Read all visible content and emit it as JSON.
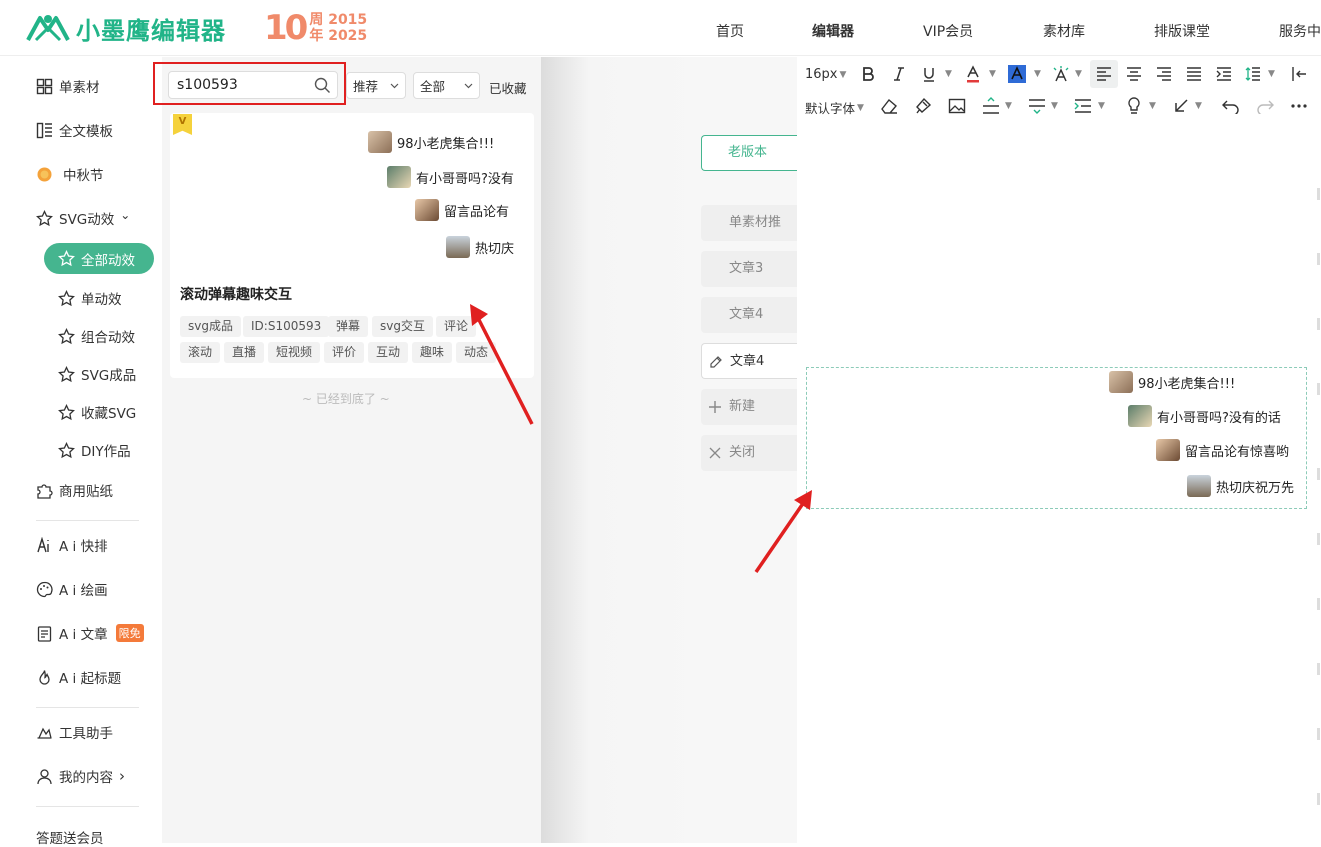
{
  "header": {
    "logo_text": "小墨鹰编辑器",
    "anniversary": {
      "number": "10",
      "year_start": "周 2015",
      "year_end": "年 2025"
    },
    "nav": [
      "首页",
      "编辑器",
      "VIP会员",
      "素材库",
      "排版课堂",
      "服务中"
    ]
  },
  "sidebar": {
    "items": [
      {
        "label": "单素材",
        "icon": "grid-icon"
      },
      {
        "label": "全文模板",
        "icon": "template-icon"
      },
      {
        "label": "中秋节",
        "icon": "moon-icon"
      },
      {
        "label": "SVG动效",
        "icon": "star-icon"
      }
    ],
    "svg_chevron": "⌄",
    "active_sub": "全部动效",
    "sub_items": [
      "单动效",
      "组合动效",
      "SVG成品",
      "收藏SVG",
      "DIY作品"
    ],
    "sticker": "商用贴纸",
    "ai": [
      {
        "label": "A i 快排",
        "icon": "ai-icon"
      },
      {
        "label": "A i 绘画",
        "icon": "palette-icon"
      },
      {
        "label": "A i 文章",
        "icon": "doc-icon",
        "badge": "限免"
      },
      {
        "label": "A i 起标题",
        "icon": "fire-icon"
      }
    ],
    "tools": "工具助手",
    "my_content": "我的内容",
    "my_content_chevron": "›",
    "quiz": "答题送会员"
  },
  "panel": {
    "search_value": "s100593",
    "sort_label": "推荐",
    "scope_label": "全部",
    "favorites": "已收藏",
    "vip_mark": "V",
    "card": {
      "danmaku": [
        "98小老虎集合!!!",
        "有小哥哥吗?没有",
        "留言品论有",
        "热切庆"
      ],
      "title": "滚动弹幕趣味交互",
      "tags_row1": [
        "svg成品",
        "ID:S100593",
        "弹幕",
        "svg交互",
        "评论"
      ],
      "tags_row2": [
        "滚动",
        "直播",
        "短视频",
        "评价",
        "互动",
        "趣味",
        "动态"
      ]
    },
    "end_note": "~ 已经到底了 ~"
  },
  "articles": {
    "old_version": "老版本",
    "items": [
      "单素材推",
      "文章3",
      "文章4"
    ],
    "active": "文章4",
    "new": "新建",
    "close": "关闭"
  },
  "toolbar": {
    "font_size": "16px",
    "default_font": "默认字体"
  },
  "editor": {
    "danmaku": [
      "98小老虎集合!!!",
      "有小哥哥吗?没有的话",
      "留言品论有惊喜哟",
      "热切庆祝万先"
    ]
  },
  "colors": {
    "brand": "#21b488",
    "active": "#45b58f",
    "highlight": "#e02020",
    "badge": "#f47a3a"
  }
}
